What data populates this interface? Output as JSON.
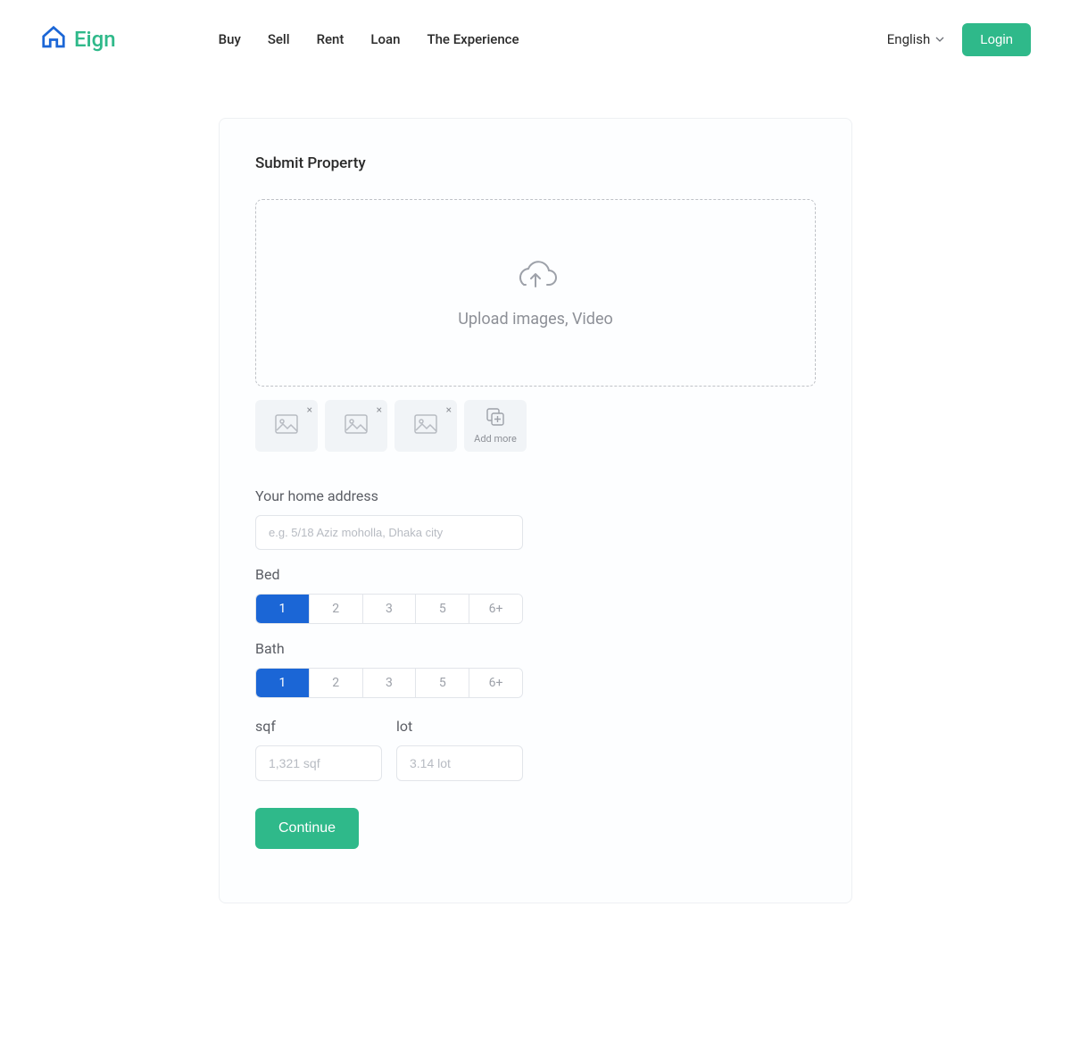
{
  "header": {
    "logo_text": "Eign",
    "nav": [
      "Buy",
      "Sell",
      "Rent",
      "Loan",
      "The Experience"
    ],
    "language": "English",
    "login": "Login"
  },
  "card": {
    "title": "Submit Property",
    "upload_text": "Upload  images, Video",
    "add_more": "Add more",
    "address_label": "Your home address",
    "address_placeholder": "e.g. 5/18 Aziz moholla, Dhaka city",
    "bed_label": "Bed",
    "bed_options": [
      "1",
      "2",
      "3",
      "5",
      "6+"
    ],
    "bed_selected": 0,
    "bath_label": "Bath",
    "bath_options": [
      "1",
      "2",
      "3",
      "5",
      "6+"
    ],
    "bath_selected": 0,
    "sqf_label": "sqf",
    "sqf_placeholder": "1,321 sqf",
    "lot_label": "lot",
    "lot_placeholder": "3.14 lot",
    "continue": "Continue"
  }
}
